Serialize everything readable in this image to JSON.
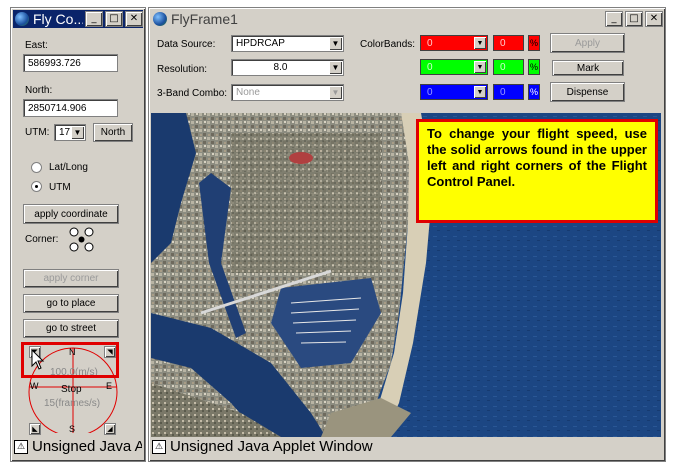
{
  "control_window": {
    "title": "Fly Co...",
    "east": {
      "label": "East:",
      "value": "586993.726"
    },
    "north": {
      "label": "North:",
      "value": "2850714.906"
    },
    "utm": {
      "label": "UTM:",
      "zone": "17",
      "north_button": "North"
    },
    "coord_mode": {
      "latlong_label": "Lat/Long",
      "utm_label": "UTM",
      "selected": "UTM"
    },
    "apply_coordinate": "apply coordinate",
    "corner_label": "Corner:",
    "apply_corner": "apply corner",
    "go_to_place": "go to place",
    "go_to_street": "go to street",
    "compass": {
      "n": "N",
      "s": "S",
      "e": "E",
      "w": "W",
      "speed": "100.0(m/s)",
      "stop": "Stop",
      "frames": "15(frames/s)"
    },
    "status": "Unsigned Java Applet Window"
  },
  "fly_frame": {
    "title": "FlyFrame1",
    "data_source": {
      "label": "Data Source:",
      "value": "HPDRCAP"
    },
    "resolution": {
      "label": "Resolution:",
      "value": "8.0"
    },
    "band_combo": {
      "label": "3-Band Combo:",
      "value": "None"
    },
    "color_bands": {
      "label": "ColorBands:",
      "red": {
        "value": "0",
        "second": "0",
        "color": "#ff0000"
      },
      "green": {
        "value": "0",
        "second": "0",
        "color": "#00ff00"
      },
      "blue": {
        "value": "0",
        "second": "0",
        "color": "#0000ff"
      },
      "pct": "%"
    },
    "apply_button": "Apply",
    "mark_button": "Mark",
    "dispense_button": "Dispense",
    "status": "Unsigned Java Applet Window"
  },
  "callout": {
    "text": "To change your flight speed, use the solid arrows found in the upper left and right corners of the Flight Control Panel."
  },
  "colors": {
    "highlight": "#e00000",
    "callout_bg": "#ffff00",
    "titlebar_active": "#0a246a"
  }
}
